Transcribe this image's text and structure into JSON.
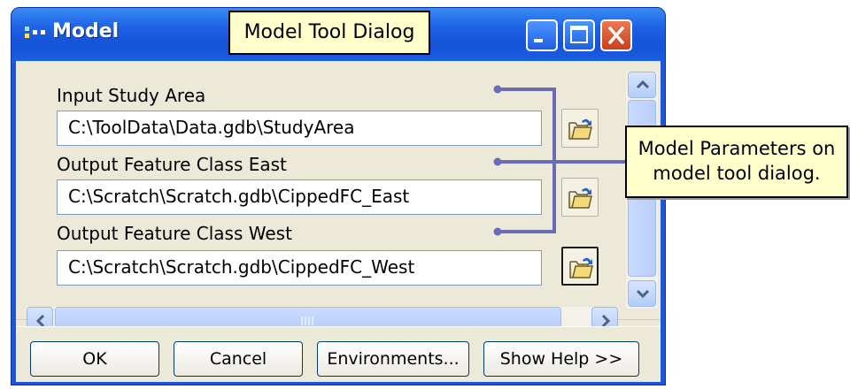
{
  "window": {
    "title": "Model"
  },
  "callouts": {
    "title_tip": "Model Tool Dialog",
    "params_tip_line1": "Model Parameters on",
    "params_tip_line2": "model tool dialog."
  },
  "parameters": [
    {
      "label": "Input Study Area",
      "value": "C:\\ToolData\\Data.gdb\\StudyArea"
    },
    {
      "label": "Output Feature Class East",
      "value": "C:\\Scratch\\Scratch.gdb\\CippedFC_East"
    },
    {
      "label": "Output Feature Class West",
      "value": "C:\\Scratch\\Scratch.gdb\\CippedFC_West"
    }
  ],
  "buttons": {
    "ok": "OK",
    "cancel": "Cancel",
    "environments": "Environments...",
    "show_help": "Show Help >>"
  },
  "icons": {
    "app": "model-builder-icon",
    "browse": "open-folder-icon",
    "minimize": "minimize-icon",
    "maximize": "maximize-icon",
    "close": "close-icon"
  },
  "colors": {
    "titlebar": "#1e63e6",
    "dialog_face": "#ece9d8",
    "tooltip_bg": "#ffffcc",
    "connector": "#6b6bb8",
    "close_button": "#c9411d"
  }
}
